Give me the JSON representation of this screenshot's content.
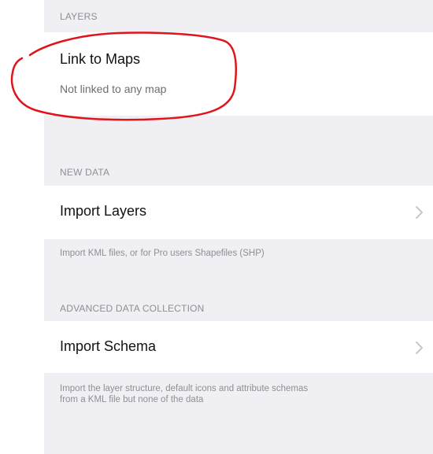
{
  "layers_section": {
    "header": "LAYERS",
    "link_title": "Link to Maps",
    "link_subtitle": "Not linked to any map"
  },
  "new_data_section": {
    "header": "NEW DATA",
    "import_layers_label": "Import Layers",
    "import_layers_footer": "Import KML files, or for Pro users Shapefiles (SHP)"
  },
  "advanced_section": {
    "header": "ADVANCED DATA COLLECTION",
    "import_schema_label": "Import Schema",
    "import_schema_footer_line1": "Import the layer structure, default icons and attribute schemas",
    "import_schema_footer_line2": "from a KML file but none of the data"
  },
  "icons": {
    "import_layers_chevron": "chevron-right-icon",
    "import_schema_chevron": "chevron-right-icon"
  },
  "colors": {
    "group_background": "#efeff4",
    "cell_background": "#ffffff",
    "annotation_circle": "#e0141b"
  }
}
